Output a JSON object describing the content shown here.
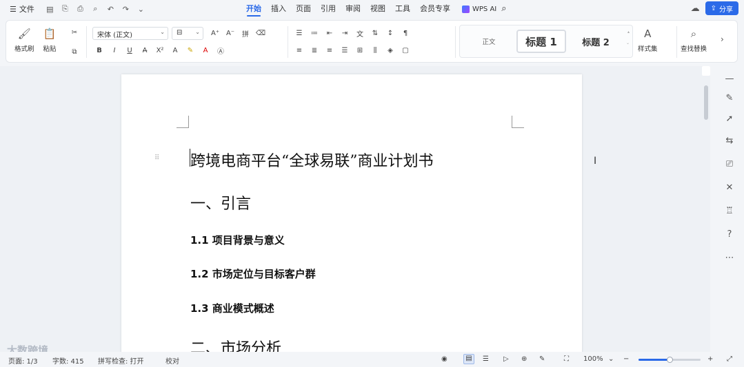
{
  "menubar": {
    "file_label": "文件",
    "tabs": [
      {
        "label": "开始"
      },
      {
        "label": "插入"
      },
      {
        "label": "页面"
      },
      {
        "label": "引用"
      },
      {
        "label": "审阅"
      },
      {
        "label": "视图"
      },
      {
        "label": "工具"
      },
      {
        "label": "会员专享"
      }
    ],
    "ai_label": "WPS AI",
    "share_label": "分享"
  },
  "ribbon": {
    "format_painter": "格式刷",
    "paste": "粘贴",
    "font_name": "宋体 (正文)",
    "style_normal": "正文",
    "style_h1": "标题 1",
    "style_h2": "标题 2",
    "style_set": "样式集",
    "find_replace": "查找替换"
  },
  "document": {
    "title": "跨境电商平台“全球易联”商业计划书",
    "headings": [
      {
        "text": "一、引言"
      },
      {
        "text": "1.1 项目背景与意义"
      },
      {
        "text": "1.2 市场定位与目标客户群"
      },
      {
        "text": "1.3 商业模式概述"
      },
      {
        "text": "二、市场分析"
      }
    ]
  },
  "watermark": "大数跨境",
  "status": {
    "page": "页面: 1/3",
    "words": "字数: 415",
    "spell": "拼写检查: 打开",
    "proof": "校对",
    "zoom": "100%",
    "zoom_level": 0.5
  }
}
